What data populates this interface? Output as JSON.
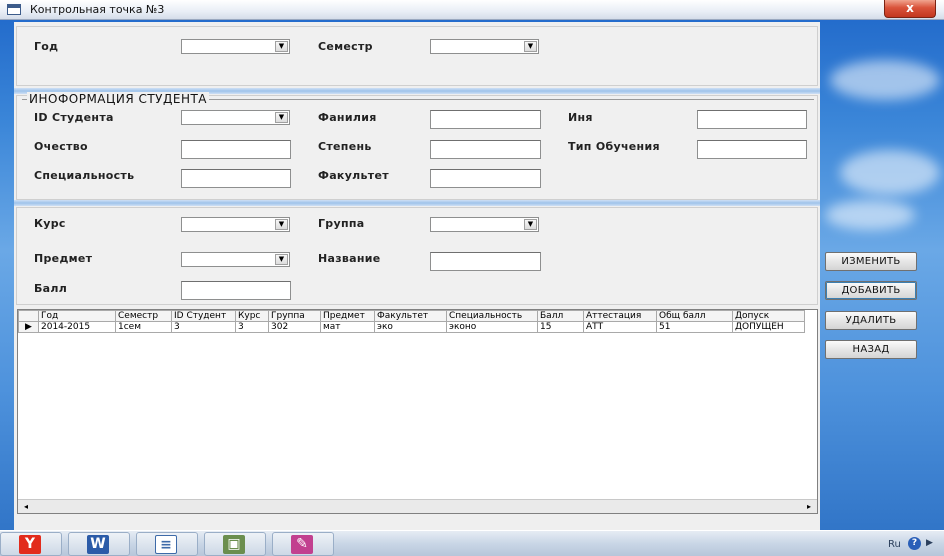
{
  "window": {
    "title": "Контрольная точка №3",
    "close_label": "x"
  },
  "top_panel": {
    "year_label": "Год",
    "semester_label": "Семестр"
  },
  "student_info": {
    "legend": "ИНОФОРМАЦИЯ СТУДЕНТА",
    "student_id_label": "ID Студента",
    "surname_label": "Фанилия",
    "name_label": "Иня",
    "patronymic_label": "Очество",
    "degree_label": "Степень",
    "study_type_label": "Тип Обучения",
    "specialty_label": "Специальность",
    "faculty_label": "Факультет"
  },
  "course_panel": {
    "course_label": "Курс",
    "group_label": "Группа",
    "subject_label": "Предмет",
    "title_label": "Название",
    "score_label": "Балл"
  },
  "buttons": {
    "edit": "ИЗМЕНИТЬ",
    "add": "ДОБАВИТЬ",
    "delete": "УДАЛИТЬ",
    "back": "НАЗАД"
  },
  "grid": {
    "columns": [
      "Год",
      "Семестр",
      "ID Студент",
      "Курс",
      "Группа",
      "Предмет",
      "Факультет",
      "Специальность",
      "Балл",
      "Аттестация",
      "Общ балл",
      "Допуск"
    ],
    "rows": [
      [
        "2014-2015",
        "1сем",
        "3",
        "3",
        "302",
        "мат",
        "эко",
        "эконо",
        "15",
        "АТТ",
        "51",
        "ДОПУЩЕН"
      ]
    ],
    "current_row_marker": "▶"
  },
  "scroll": {
    "left_arrow": "◂",
    "right_arrow": "▸"
  },
  "taskbar": {
    "apps": [
      "yandex-browser",
      "word",
      "document",
      "installer",
      "paint"
    ],
    "lang": "Ru",
    "help": "?"
  }
}
